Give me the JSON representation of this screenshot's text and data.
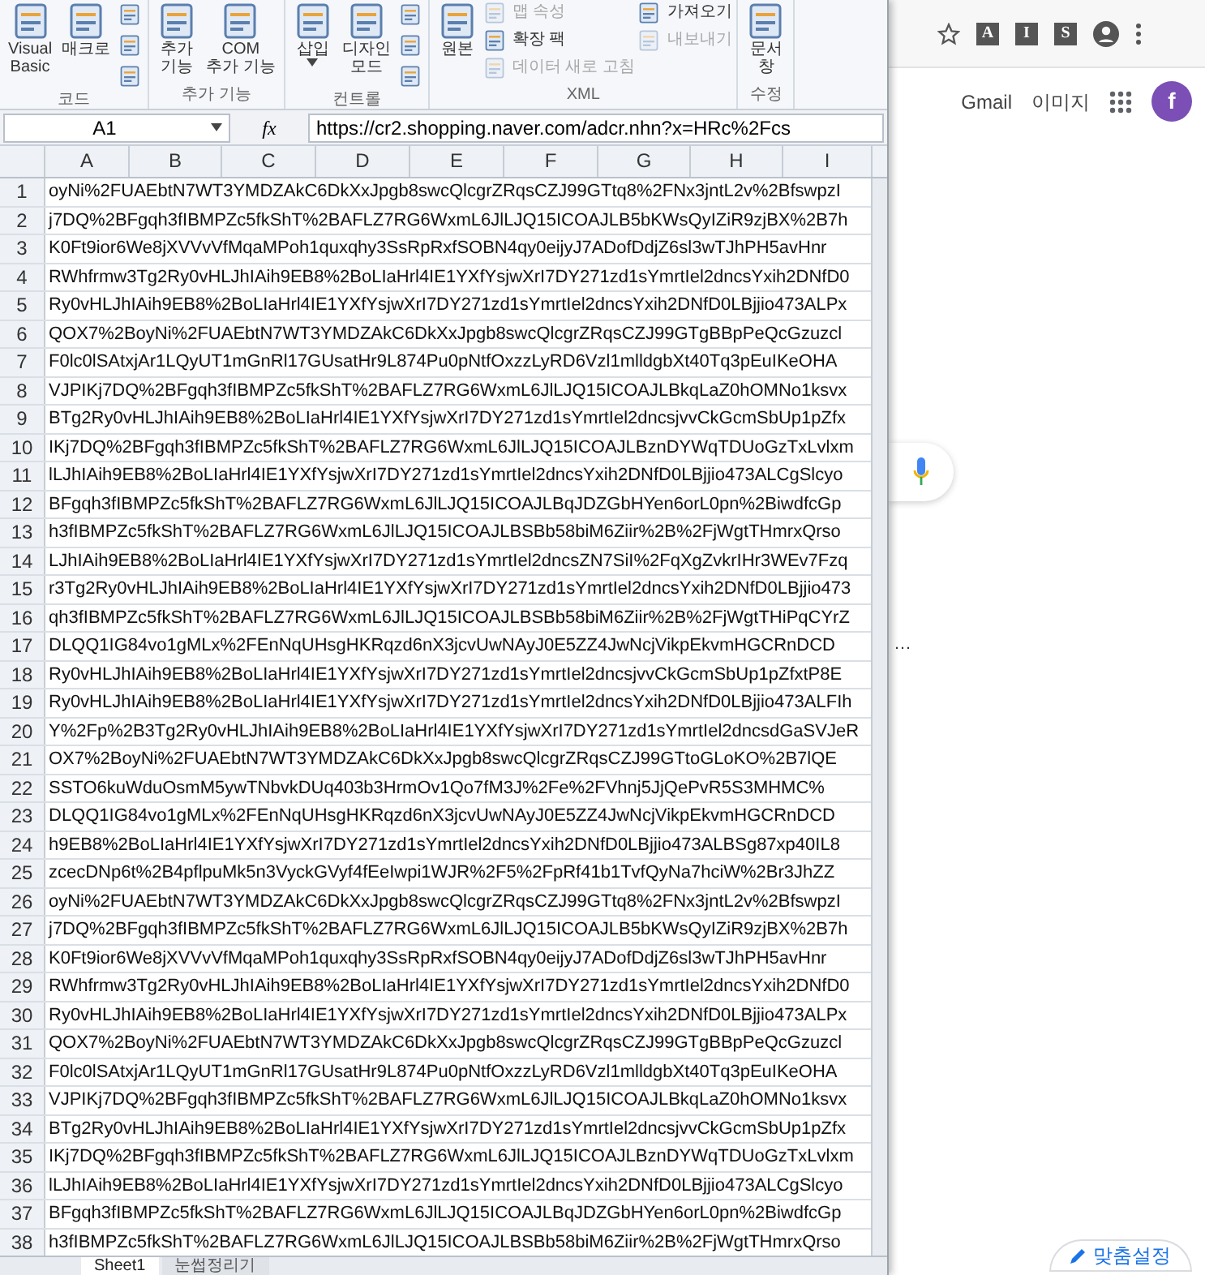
{
  "ribbon": {
    "groups": [
      {
        "label": "코드",
        "items": [
          {
            "kind": "large",
            "lines": [
              "Visual",
              "Basic"
            ]
          },
          {
            "kind": "large",
            "lines": [
              "매크로"
            ]
          },
          {
            "kind": "icon"
          },
          {
            "kind": "icon"
          },
          {
            "kind": "icon"
          }
        ]
      },
      {
        "label": "추가 기능",
        "items": [
          {
            "kind": "large",
            "lines": [
              "추가",
              "기능"
            ]
          },
          {
            "kind": "large",
            "lines": [
              "COM",
              "추가 기능"
            ]
          }
        ]
      },
      {
        "label": "컨트롤",
        "items": [
          {
            "kind": "large",
            "lines": [
              "삽입"
            ],
            "dropdown": true
          },
          {
            "kind": "large",
            "lines": [
              "디자인",
              "모드"
            ]
          },
          {
            "kind": "icon"
          },
          {
            "kind": "icon"
          },
          {
            "kind": "icon"
          }
        ]
      },
      {
        "label": "XML",
        "items": [
          {
            "kind": "large",
            "lines": [
              "원본"
            ]
          },
          {
            "kind": "small",
            "lines": [
              "맵 속성"
            ],
            "disabled": true
          },
          {
            "kind": "small",
            "lines": [
              "확장 팩"
            ],
            "disabled": false
          },
          {
            "kind": "small",
            "lines": [
              "데이터 새로 고침"
            ],
            "disabled": true
          },
          {
            "kind": "small",
            "lines": [
              "가져오기"
            ],
            "disabled": false
          },
          {
            "kind": "small",
            "lines": [
              "내보내기"
            ],
            "disabled": true
          }
        ]
      },
      {
        "label": "수정",
        "items": [
          {
            "kind": "large",
            "lines": [
              "문서",
              "창"
            ]
          }
        ]
      }
    ]
  },
  "formula_bar": {
    "name_box": "A1",
    "function_label": "fx",
    "formula": "https://cr2.shopping.naver.com/adcr.nhn?x=HRc%2Fcs"
  },
  "columns": [
    "A",
    "B",
    "C",
    "D",
    "E",
    "F",
    "G",
    "H",
    "I"
  ],
  "rows": [
    {
      "number": "1",
      "cell": "oyNi%2FUAEbtN7WT3YMDZAkC6DkXxJpgb8swcQlcgrZRqsCZJ99GTtq8%2FNx3jntL2v%2BfswpzI"
    },
    {
      "number": "2",
      "cell": "j7DQ%2BFgqh3fIBMPZc5fkShT%2BAFLZ7RG6WxmL6JlLJQ15ICOAJLB5bKWsQyIZiR9zjBX%2B7h"
    },
    {
      "number": "3",
      "cell": "K0Ft9ior6We8jXVVvVfMqaMPoh1quxqhy3SsRpRxfSOBN4qy0eijyJ7ADofDdjZ6sl3wTJhPH5avHnr"
    },
    {
      "number": "4",
      "cell": "RWhfrmw3Tg2Ry0vHLJhIAih9EB8%2BoLIaHrl4IE1YXfYsjwXrI7DY271zd1sYmrtIel2dncsYxih2DNfD0"
    },
    {
      "number": "5",
      "cell": "Ry0vHLJhIAih9EB8%2BoLIaHrl4IE1YXfYsjwXrI7DY271zd1sYmrtIel2dncsYxih2DNfD0LBjjio473ALPx"
    },
    {
      "number": "6",
      "cell": "QOX7%2BoyNi%2FUAEbtN7WT3YMDZAkC6DkXxJpgb8swcQlcgrZRqsCZJ99GTgBBpPeQcGzuzcl"
    },
    {
      "number": "7",
      "cell": "F0lc0lSAtxjAr1LQyUT1mGnRl17GUsatHr9L874Pu0pNtfOxzzLyRD6Vzl1mlldgbXt40Tq3pEuIKeOHA"
    },
    {
      "number": "8",
      "cell": "VJPIKj7DQ%2BFgqh3fIBMPZc5fkShT%2BAFLZ7RG6WxmL6JlLJQ15ICOAJLBkqLaZ0hOMNo1ksvx"
    },
    {
      "number": "9",
      "cell": "BTg2Ry0vHLJhIAih9EB8%2BoLIaHrl4IE1YXfYsjwXrI7DY271zd1sYmrtIel2dncsjvvCkGcmSbUp1pZfx"
    },
    {
      "number": "10",
      "cell": "IKj7DQ%2BFgqh3fIBMPZc5fkShT%2BAFLZ7RG6WxmL6JlLJQ15ICOAJLBznDYWqTDUoGzTxLvlxm"
    },
    {
      "number": "11",
      "cell": "lLJhIAih9EB8%2BoLIaHrl4IE1YXfYsjwXrI7DY271zd1sYmrtIel2dncsYxih2DNfD0LBjjio473ALCgSlcyo"
    },
    {
      "number": "12",
      "cell": "BFgqh3fIBMPZc5fkShT%2BAFLZ7RG6WxmL6JlLJQ15ICOAJLBqJDZGbHYen6orL0pn%2BiwdfcGp"
    },
    {
      "number": "13",
      "cell": "h3fIBMPZc5fkShT%2BAFLZ7RG6WxmL6JlLJQ15ICOAJLBSBb58biM6Ziir%2B%2FjWgtTHmrxQrso"
    },
    {
      "number": "14",
      "cell": "LJhIAih9EB8%2BoLIaHrl4IE1YXfYsjwXrI7DY271zd1sYmrtIel2dncsZN7SiI%2FqXgZvkrIHr3WEv7Fzq"
    },
    {
      "number": "15",
      "cell": "r3Tg2Ry0vHLJhIAih9EB8%2BoLIaHrl4IE1YXfYsjwXrI7DY271zd1sYmrtIel2dncsYxih2DNfD0LBjjio473"
    },
    {
      "number": "16",
      "cell": "qh3fIBMPZc5fkShT%2BAFLZ7RG6WxmL6JlLJQ15ICOAJLBSBb58biM6Ziir%2B%2FjWgtTHiPqCYrZ"
    },
    {
      "number": "17",
      "cell": "DLQQ1IG84vo1gMLx%2FEnNqUHsgHKRqzd6nX3jcvUwNAyJ0E5ZZ4JwNcjVikpEkvmHGCRnDCD"
    },
    {
      "number": "18",
      "cell": "Ry0vHLJhIAih9EB8%2BoLIaHrl4IE1YXfYsjwXrI7DY271zd1sYmrtIel2dncsjvvCkGcmSbUp1pZfxtP8E"
    },
    {
      "number": "19",
      "cell": "Ry0vHLJhIAih9EB8%2BoLIaHrl4IE1YXfYsjwXrI7DY271zd1sYmrtIel2dncsYxih2DNfD0LBjjio473ALFIh"
    },
    {
      "number": "20",
      "cell": "Y%2Fp%2B3Tg2Ry0vHLJhIAih9EB8%2BoLIaHrl4IE1YXfYsjwXrI7DY271zd1sYmrtIel2dncsdGaSVJeR"
    },
    {
      "number": "21",
      "cell": "OX7%2BoyNi%2FUAEbtN7WT3YMDZAkC6DkXxJpgb8swcQlcgrZRqsCZJ99GTtoGLoKO%2B7lQE"
    },
    {
      "number": "22",
      "cell": "SSTO6kuWduOsmM5ywTNbvkDUq403b3HrmOv1Qo7fM3J%2Fe%2FVhnj5JjQePvR5S3MHMC%"
    },
    {
      "number": "23",
      "cell": "DLQQ1IG84vo1gMLx%2FEnNqUHsgHKRqzd6nX3jcvUwNAyJ0E5ZZ4JwNcjVikpEkvmHGCRnDCD"
    },
    {
      "number": "24",
      "cell": "h9EB8%2BoLIaHrl4IE1YXfYsjwXrI7DY271zd1sYmrtIel2dncsYxih2DNfD0LBjjio473ALBSg87xp40IL8"
    },
    {
      "number": "25",
      "cell": "zcecDNp6t%2B4pflpuMk5n3VyckGVyf4fEeIwpi1WJR%2F5%2FpRf41b1TvfQyNa7hciW%2Br3JhZZ"
    },
    {
      "number": "26",
      "cell": "oyNi%2FUAEbtN7WT3YMDZAkC6DkXxJpgb8swcQlcgrZRqsCZJ99GTtq8%2FNx3jntL2v%2BfswpzI"
    },
    {
      "number": "27",
      "cell": "j7DQ%2BFgqh3fIBMPZc5fkShT%2BAFLZ7RG6WxmL6JlLJQ15ICOAJLB5bKWsQyIZiR9zjBX%2B7h"
    },
    {
      "number": "28",
      "cell": "K0Ft9ior6We8jXVVvVfMqaMPoh1quxqhy3SsRpRxfSOBN4qy0eijyJ7ADofDdjZ6sl3wTJhPH5avHnr"
    },
    {
      "number": "29",
      "cell": "RWhfrmw3Tg2Ry0vHLJhIAih9EB8%2BoLIaHrl4IE1YXfYsjwXrI7DY271zd1sYmrtIel2dncsYxih2DNfD0"
    },
    {
      "number": "30",
      "cell": "Ry0vHLJhIAih9EB8%2BoLIaHrl4IE1YXfYsjwXrI7DY271zd1sYmrtIel2dncsYxih2DNfD0LBjjio473ALPx"
    },
    {
      "number": "31",
      "cell": "QOX7%2BoyNi%2FUAEbtN7WT3YMDZAkC6DkXxJpgb8swcQlcgrZRqsCZJ99GTgBBpPeQcGzuzcl"
    },
    {
      "number": "32",
      "cell": "F0lc0lSAtxjAr1LQyUT1mGnRl17GUsatHr9L874Pu0pNtfOxzzLyRD6Vzl1mlldgbXt40Tq3pEuIKeOHA"
    },
    {
      "number": "33",
      "cell": "VJPIKj7DQ%2BFgqh3fIBMPZc5fkShT%2BAFLZ7RG6WxmL6JlLJQ15ICOAJLBkqLaZ0hOMNo1ksvx"
    },
    {
      "number": "34",
      "cell": "BTg2Ry0vHLJhIAih9EB8%2BoLIaHrl4IE1YXfYsjwXrI7DY271zd1sYmrtIel2dncsjvvCkGcmSbUp1pZfx"
    },
    {
      "number": "35",
      "cell": "IKj7DQ%2BFgqh3fIBMPZc5fkShT%2BAFLZ7RG6WxmL6JlLJQ15ICOAJLBznDYWqTDUoGzTxLvlxm"
    },
    {
      "number": "36",
      "cell": "lLJhIAih9EB8%2BoLIaHrl4IE1YXfYsjwXrI7DY271zd1sYmrtIel2dncsYxih2DNfD0LBjjio473ALCgSlcyo"
    },
    {
      "number": "37",
      "cell": "BFgqh3fIBMPZc5fkShT%2BAFLZ7RG6WxmL6JlLJQ15ICOAJLBqJDZGbHYen6orL0pn%2BiwdfcGp"
    },
    {
      "number": "38",
      "cell": "h3fIBMPZc5fkShT%2BAFLZ7RG6WxmL6JlLJQ15ICOAJLBSBb58biM6Ziir%2B%2FjWgtTHmrxQrso"
    }
  ],
  "sheet_tabs": [
    {
      "label": "Sheet1",
      "selected": true
    },
    {
      "label": "눈썹정리기",
      "selected": false
    }
  ],
  "browser": {
    "extensions": [
      "A",
      "I",
      "S"
    ],
    "links": [
      "Gmail",
      "이미지"
    ],
    "avatar": "f",
    "partial_text": "…",
    "customize_button": "맞춤설정"
  }
}
